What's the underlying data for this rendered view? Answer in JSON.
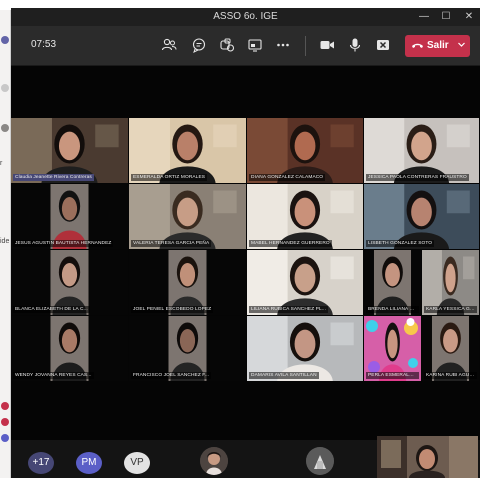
{
  "window": {
    "title": "ASSO 6o. IGE",
    "minimize_glyph": "—",
    "maximize_glyph": "☐",
    "close_glyph": "✕"
  },
  "toolbar": {
    "timer": "07:53",
    "leave_label": "Salir",
    "icons": [
      "participants-icon",
      "chat-icon",
      "reactions-icon",
      "share-screen-icon",
      "more-options-icon",
      "camera-icon",
      "microphone-icon",
      "share-tray-icon"
    ],
    "leave_color": "#c4314b"
  },
  "side_strip": {
    "letters": [
      "r",
      "ide"
    ]
  },
  "participants": [
    {
      "name": "Claudia Jeanette Rivera Contreras",
      "highlight": true
    },
    {
      "name": "ESMERALDA ORTIZ MORALES"
    },
    {
      "name": "DIANA GONZALEZ CALAMACO"
    },
    {
      "name": "JESSICA PAOLA CONTRERAS FRAUSTRO"
    },
    {
      "name": "JESUS AGUSTIN BAUTISTA HERNANDEZ"
    },
    {
      "name": "VALERIA TERESA GARCIA PEÑA"
    },
    {
      "name": "MABEL HERNANDEZ GUERRERO"
    },
    {
      "name": "LISBETH GONZALEZ SOTO"
    },
    {
      "name": "BLANCA ELIZABETH DE LA C..."
    },
    {
      "name": "JOEL PENIEL ESCOBEDO LOPEZ"
    },
    {
      "name": "LILIANA RUBICA SANCHEZ PL..."
    },
    {
      "name": "BRENDA LILIANA SOLIS TOR..."
    },
    {
      "name": "KARLA YESSICA GUTIERREZ R..."
    },
    {
      "name": "WENDY JOVANNA REYES CAS..."
    },
    {
      "name": "FRANCISCO JOEL SANCHEZ F..."
    },
    {
      "name": "DAMARIS AVILA SANTILLAN"
    },
    {
      "name": "PERLA ESMERALDA RAMIREZ..."
    },
    {
      "name": "KARINA RUBI AGUIRRE GON..."
    }
  ],
  "tray": {
    "avatars": [
      {
        "initials": "+17",
        "color": "#464775"
      },
      {
        "initials": "PM",
        "color": "#5b5fc7"
      },
      {
        "initials": "VP",
        "color": "#e3e3e3"
      }
    ]
  }
}
